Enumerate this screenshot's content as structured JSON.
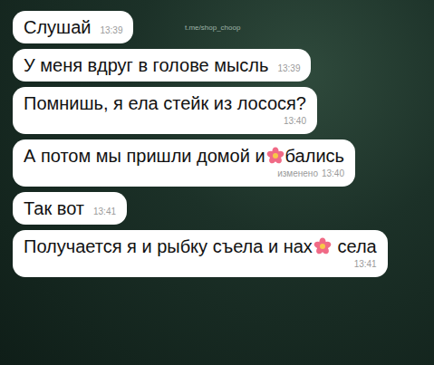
{
  "watermark": "t.me/shop_choop",
  "messages": [
    {
      "kind": "inline",
      "parts": [
        {
          "kind": "text",
          "text": "Слушай"
        }
      ],
      "time": "13:39",
      "edited": ""
    },
    {
      "kind": "inline",
      "parts": [
        {
          "kind": "text",
          "text": "У меня вдруг в голове мысль"
        }
      ],
      "time": "13:39",
      "edited": ""
    },
    {
      "kind": "stacked",
      "parts": [
        {
          "kind": "text",
          "text": "Помнишь, я ела стейк из лосося?"
        }
      ],
      "time": "13:40",
      "edited": ""
    },
    {
      "kind": "stacked",
      "parts": [
        {
          "kind": "text",
          "text": "А потом мы пришли домой и"
        },
        {
          "kind": "censor",
          "text": ""
        },
        {
          "kind": "text",
          "text": "бались"
        }
      ],
      "time": "13:40",
      "edited": "изменено"
    },
    {
      "kind": "inline",
      "parts": [
        {
          "kind": "text",
          "text": "Так вот"
        }
      ],
      "time": "13:41",
      "edited": ""
    },
    {
      "kind": "stacked",
      "parts": [
        {
          "kind": "text",
          "text": "Получается я и рыбку съела и нах"
        },
        {
          "kind": "censor",
          "text": ""
        },
        {
          "kind": "text",
          "text": " села"
        }
      ],
      "time": "13:41",
      "edited": ""
    }
  ]
}
